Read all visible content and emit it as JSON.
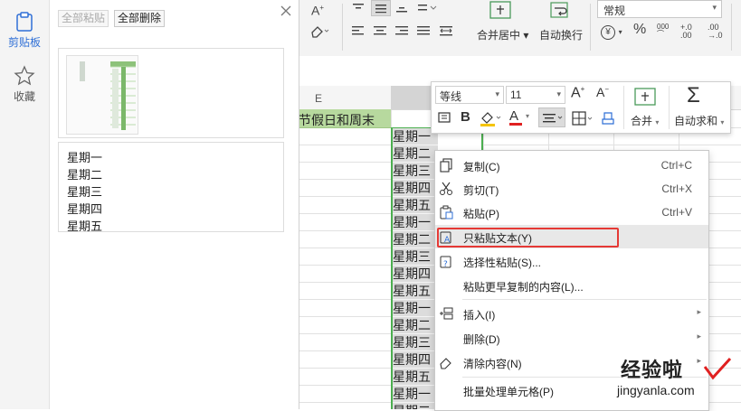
{
  "clipboard_panel": {
    "tabs": [
      {
        "label": "剪贴板",
        "icon": "clipboard-icon"
      },
      {
        "label": "收藏",
        "icon": "star-icon"
      }
    ],
    "paste_all": "全部粘贴",
    "delete_all": "全部删除",
    "text_item_lines": [
      "星期一",
      "星期二",
      "星期三",
      "星期四",
      "星期五"
    ]
  },
  "ribbon": {
    "merge_center": "合并居中",
    "wrap_text": "自动换行",
    "number_format": "常规",
    "currency_symbol": "¥",
    "percent_symbol": "%",
    "thousands_symbol": "000",
    "increase_decimal": "+.0 .00",
    "decrease_decimal": ".00 →.0",
    "font_grow": "A",
    "font_shrink": "A"
  },
  "sheet": {
    "column_header": "E",
    "header_cell": "节假日和周末",
    "column_values": [
      "星期一",
      "星期二",
      "星期三",
      "星期四",
      "星期五",
      "星期一",
      "星期二",
      "星期三",
      "星期四",
      "星期五",
      "星期一",
      "星期二",
      "星期三",
      "星期四",
      "星期五",
      "星期一",
      "星期二"
    ],
    "accent_color": "#4caf50",
    "header_fill": "#b7d99e"
  },
  "mini_toolbar": {
    "font_name": "等线",
    "font_size": "11",
    "merge": "合并",
    "autosum": "自动求和",
    "bold": "B",
    "font_color_letter": "A",
    "font_color": "#e02020",
    "fill_color": "#f5c400"
  },
  "context_menu": {
    "items": [
      {
        "label": "复制(C)",
        "shortcut": "Ctrl+C",
        "icon": "copy-icon"
      },
      {
        "label": "剪切(T)",
        "shortcut": "Ctrl+X",
        "icon": "scissors-icon"
      },
      {
        "label": "粘贴(P)",
        "shortcut": "Ctrl+V",
        "icon": "paste-icon"
      },
      {
        "label": "只粘贴文本(Y)",
        "icon": "paste-text-icon"
      },
      {
        "label": "选择性粘贴(S)...",
        "icon": "paste-special-icon"
      },
      {
        "label": "粘贴更早复制的内容(L)..."
      },
      {
        "label": "插入(I)",
        "icon": "insert-icon"
      },
      {
        "label": "删除(D)"
      },
      {
        "label": "清除内容(N)",
        "icon": "eraser-icon"
      },
      {
        "label": "批量处理单元格(P)"
      }
    ],
    "highlight_color": "#e53935"
  },
  "watermark": {
    "text": "经验啦",
    "url": "jingyanla.com"
  }
}
